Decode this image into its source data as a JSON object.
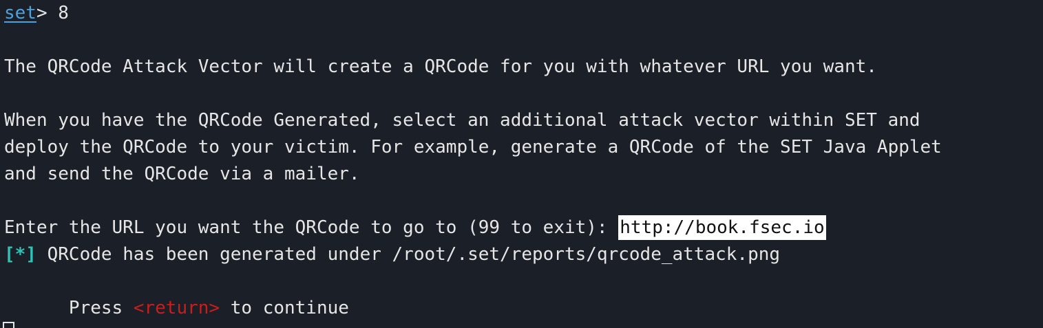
{
  "terminal": {
    "prompt_label": "set",
    "prompt_symbol": ">",
    "prompt_entry": " 8",
    "intro_line": "The QRCode Attack Vector will create a QRCode for you with whatever URL you want.",
    "desc_line_1": "When you have the QRCode Generated, select an additional attack vector within SET and",
    "desc_line_2": "deploy the QRCode to your victim. For example, generate a QRCode of the SET Java Applet",
    "desc_line_3": "and send the QRCode via a mailer.",
    "url_prompt": "Enter the URL you want the QRCode to go to (99 to exit): ",
    "url_value": "http://book.fsec.io",
    "status_marker": "[*]",
    "status_message": " QRCode has been generated under /root/.set/reports/qrcode_attack.png",
    "press_prefix": "      Press ",
    "return_key": "<return>",
    "press_suffix": " to continue"
  },
  "colors": {
    "background": "#1b1f28",
    "text": "#e6e6e6",
    "prompt": "#4aa3e0",
    "status": "#2ec4b6",
    "return_key": "#c81e1e"
  }
}
